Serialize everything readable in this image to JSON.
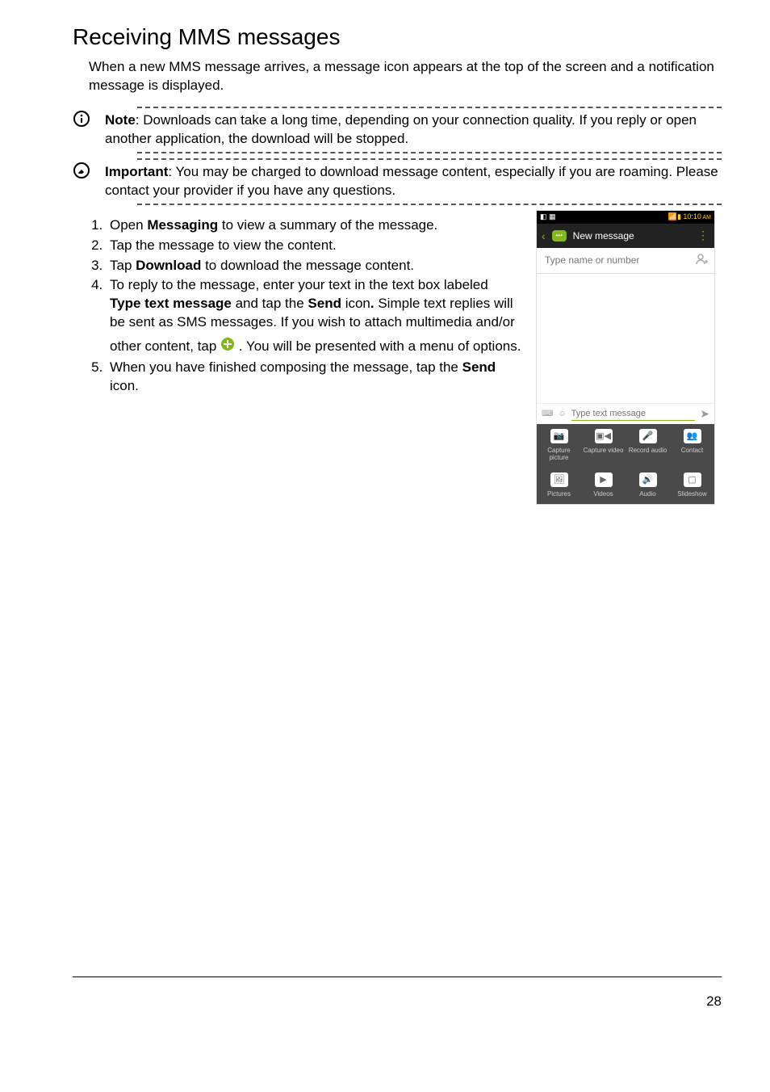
{
  "heading": "Receiving MMS messages",
  "intro": "When a new MMS message arrives, a message icon appears at the top of the screen and a notification message is displayed.",
  "note": {
    "label": "Note",
    "text": ": Downloads can take a long time, depending on your connection quality. If you reply or open another application, the download will be stopped."
  },
  "important": {
    "label": "Important",
    "text": ": You may be charged to download message content, especially if you are roaming. Please contact your provider if you have any questions."
  },
  "steps": {
    "s1a": "Open ",
    "s1b": "Messaging",
    "s1c": " to view a summary of the message.",
    "s2": "Tap the message to view the content.",
    "s3a": "Tap ",
    "s3b": "Download",
    "s3c": " to download the message content.",
    "s4a": "To reply to the message, enter your text in the text box labeled ",
    "s4b": "Type text message",
    "s4c": " and tap the ",
    "s4d": "Send",
    "s4e": " icon",
    "s4f": ".",
    "s4g": " Simple text replies will be sent as SMS messages. If you wish to attach multimedia and/or",
    "s4h_a": "other content, tap ",
    "s4h_b": " . You will be presented with a menu of options.",
    "s5a": "When you have finished composing the message, tap the ",
    "s5b": "Send",
    "s5c": " icon."
  },
  "phone": {
    "time": "10:10",
    "title": "New message",
    "to_placeholder": "Type name or number",
    "compose_placeholder": "Type text message",
    "grid": {
      "capture_picture": "Capture picture",
      "capture_video": "Capture video",
      "record_audio": "Record audio",
      "contact": "Contact",
      "pictures": "Pictures",
      "videos": "Videos",
      "audio": "Audio",
      "slideshow": "Slideshow"
    }
  },
  "page_number": "28"
}
